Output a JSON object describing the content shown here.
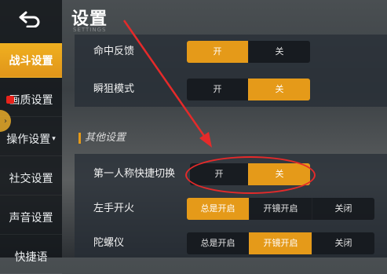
{
  "header": {
    "title": "设置",
    "subtitle": "SETTINGS"
  },
  "sidebar": {
    "items": [
      {
        "label": "战斗设置",
        "active": true
      },
      {
        "label": "画质设置",
        "active": false
      },
      {
        "label": "操作设置",
        "active": false,
        "caret": "▾"
      },
      {
        "label": "社交设置",
        "active": false
      },
      {
        "label": "声音设置",
        "active": false
      },
      {
        "label": "快捷语",
        "active": false
      }
    ]
  },
  "main": {
    "rows": [
      {
        "label": "命中反馈",
        "options": [
          "开",
          "关"
        ],
        "selected": 0
      },
      {
        "label": "瞬狙模式",
        "options": [
          "开",
          "关"
        ],
        "selected": 1
      }
    ],
    "section_title": "其他设置",
    "section_rows": [
      {
        "label": "第一人称快捷切换",
        "options": [
          "开",
          "关"
        ],
        "selected": 1
      },
      {
        "label": "左手开火",
        "options": [
          "总是开启",
          "开镜开启",
          "关闭"
        ],
        "selected": 0
      },
      {
        "label": "陀螺仪",
        "options": [
          "总是开启",
          "开镜开启",
          "关闭"
        ],
        "selected": 1
      }
    ]
  },
  "colors": {
    "accent": "#e59a19",
    "annotation": "#e52a2a"
  },
  "icons": {
    "back": "back-arrow-icon"
  }
}
